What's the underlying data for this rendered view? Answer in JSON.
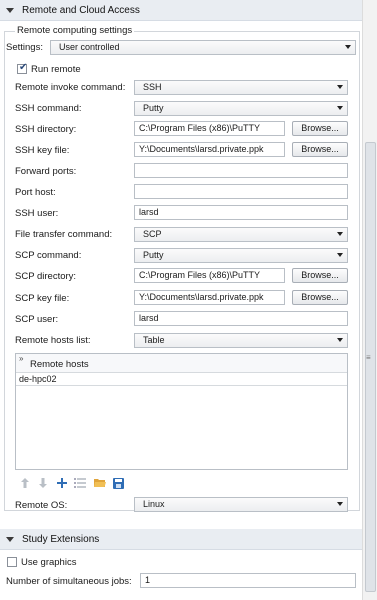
{
  "sections": {
    "remote": "Remote and Cloud Access",
    "study": "Study Extensions"
  },
  "group_title": "Remote computing settings",
  "settings": {
    "label": "Settings:",
    "value": "User controlled"
  },
  "run_remote": {
    "label": "Run remote",
    "checked": true
  },
  "rows": {
    "invoke": {
      "label": "Remote invoke command:",
      "value": "SSH"
    },
    "ssh_cmd": {
      "label": "SSH command:",
      "value": "Putty"
    },
    "ssh_dir": {
      "label": "SSH directory:",
      "value": "C:\\Program Files (x86)\\PuTTY"
    },
    "ssh_key": {
      "label": "SSH key file:",
      "value": "Y:\\Documents\\larsd.private.ppk"
    },
    "fwd_ports": {
      "label": "Forward ports:",
      "value": ""
    },
    "port_host": {
      "label": "Port host:",
      "value": ""
    },
    "ssh_user": {
      "label": "SSH user:",
      "value": "larsd"
    },
    "ftc": {
      "label": "File transfer command:",
      "value": "SCP"
    },
    "scp_cmd": {
      "label": "SCP command:",
      "value": "Putty"
    },
    "scp_dir": {
      "label": "SCP directory:",
      "value": "C:\\Program Files (x86)\\PuTTY"
    },
    "scp_key": {
      "label": "SCP key file:",
      "value": "Y:\\Documents\\larsd.private.ppk"
    },
    "scp_user": {
      "label": "SCP user:",
      "value": "larsd"
    },
    "hosts_list": {
      "label": "Remote hosts list:",
      "value": "Table"
    }
  },
  "browse": "Browse...",
  "hosts_table": {
    "header": "Remote hosts",
    "rows": [
      "de-hpc02"
    ]
  },
  "remote_os": {
    "label": "Remote OS:",
    "value": "Linux"
  },
  "use_graphics": {
    "label": "Use graphics",
    "checked": false
  },
  "jobs": {
    "label": "Number of simultaneous jobs:",
    "value": "1"
  },
  "colors": {
    "header_bg": "#e9edf2",
    "accent": "#2f6db5"
  }
}
